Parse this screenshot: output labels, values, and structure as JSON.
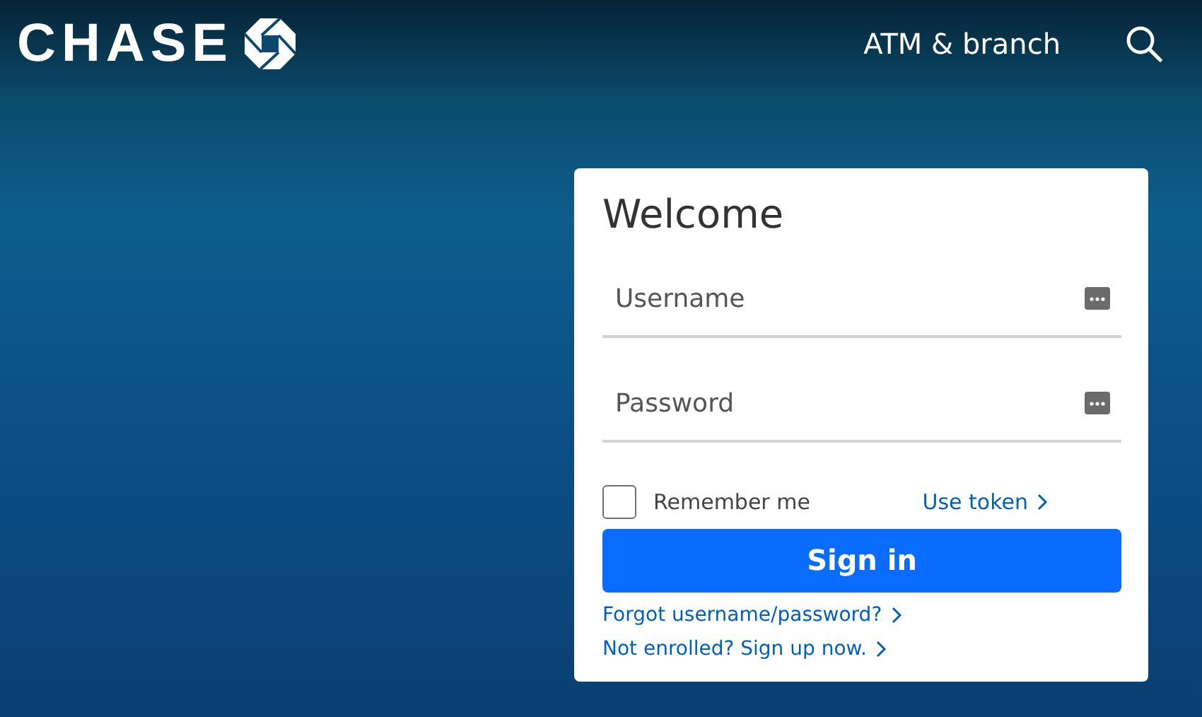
{
  "header": {
    "logo": "CHASE",
    "nav_link": "ATM & branch"
  },
  "login": {
    "title": "Welcome",
    "fields": [
      {
        "placeholder": "Username"
      },
      {
        "placeholder": "Password"
      }
    ],
    "remember": {
      "label": "Remember me",
      "checked": false
    },
    "token_link": "Use token",
    "button": "Sign in",
    "links": [
      "Forgot username/password?",
      "Not enrolled? Sign up now."
    ]
  }
}
